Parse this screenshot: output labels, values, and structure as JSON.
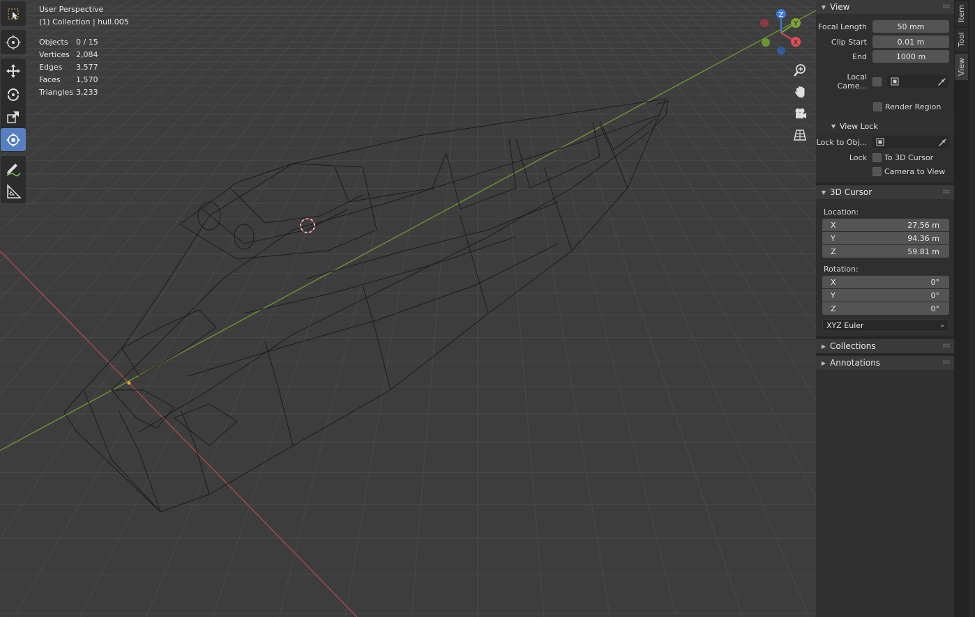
{
  "overlay": {
    "view_name": "User Perspective",
    "collection_info": "(1) Collection | hull.005",
    "stats": [
      {
        "label": "Objects",
        "value": "0 / 15"
      },
      {
        "label": "Vertices",
        "value": "2,084"
      },
      {
        "label": "Edges",
        "value": "3,577"
      },
      {
        "label": "Faces",
        "value": "1,570"
      },
      {
        "label": "Triangles",
        "value": "3,233"
      }
    ]
  },
  "gizmo": {
    "z": "Z",
    "y": "Y",
    "x": "X"
  },
  "tabs": {
    "item": "Item",
    "tool": "Tool",
    "view": "View"
  },
  "view_panel": {
    "title": "View",
    "focal_length_label": "Focal Length",
    "focal_length_value": "50 mm",
    "clip_start_label": "Clip Start",
    "clip_start_value": "0.01 m",
    "end_label": "End",
    "end_value": "1000 m",
    "local_camera_label": "Local Came...",
    "render_region_label": "Render Region"
  },
  "view_lock": {
    "title": "View Lock",
    "lock_to_obj_label": "Lock to Obj...",
    "lock_label": "Lock",
    "to_3d_cursor_label": "To 3D Cursor",
    "camera_to_view_label": "Camera to View"
  },
  "cursor_panel": {
    "title": "3D Cursor",
    "location_label": "Location:",
    "location": [
      {
        "axis": "X",
        "value": "27.56 m"
      },
      {
        "axis": "Y",
        "value": "94.36 m"
      },
      {
        "axis": "Z",
        "value": "59.81 m"
      }
    ],
    "rotation_label": "Rotation:",
    "rotation": [
      {
        "axis": "X",
        "value": "0°"
      },
      {
        "axis": "Y",
        "value": "0°"
      },
      {
        "axis": "Z",
        "value": "0°"
      }
    ],
    "rotation_mode": "XYZ Euler"
  },
  "collapsed_panels": {
    "collections": "Collections",
    "annotations": "Annotations"
  },
  "colors": {
    "accent_active_tool": "#5680c2",
    "axis_x": "#d44a55",
    "axis_y": "#7ea33a",
    "axis_z": "#3d79d6"
  }
}
